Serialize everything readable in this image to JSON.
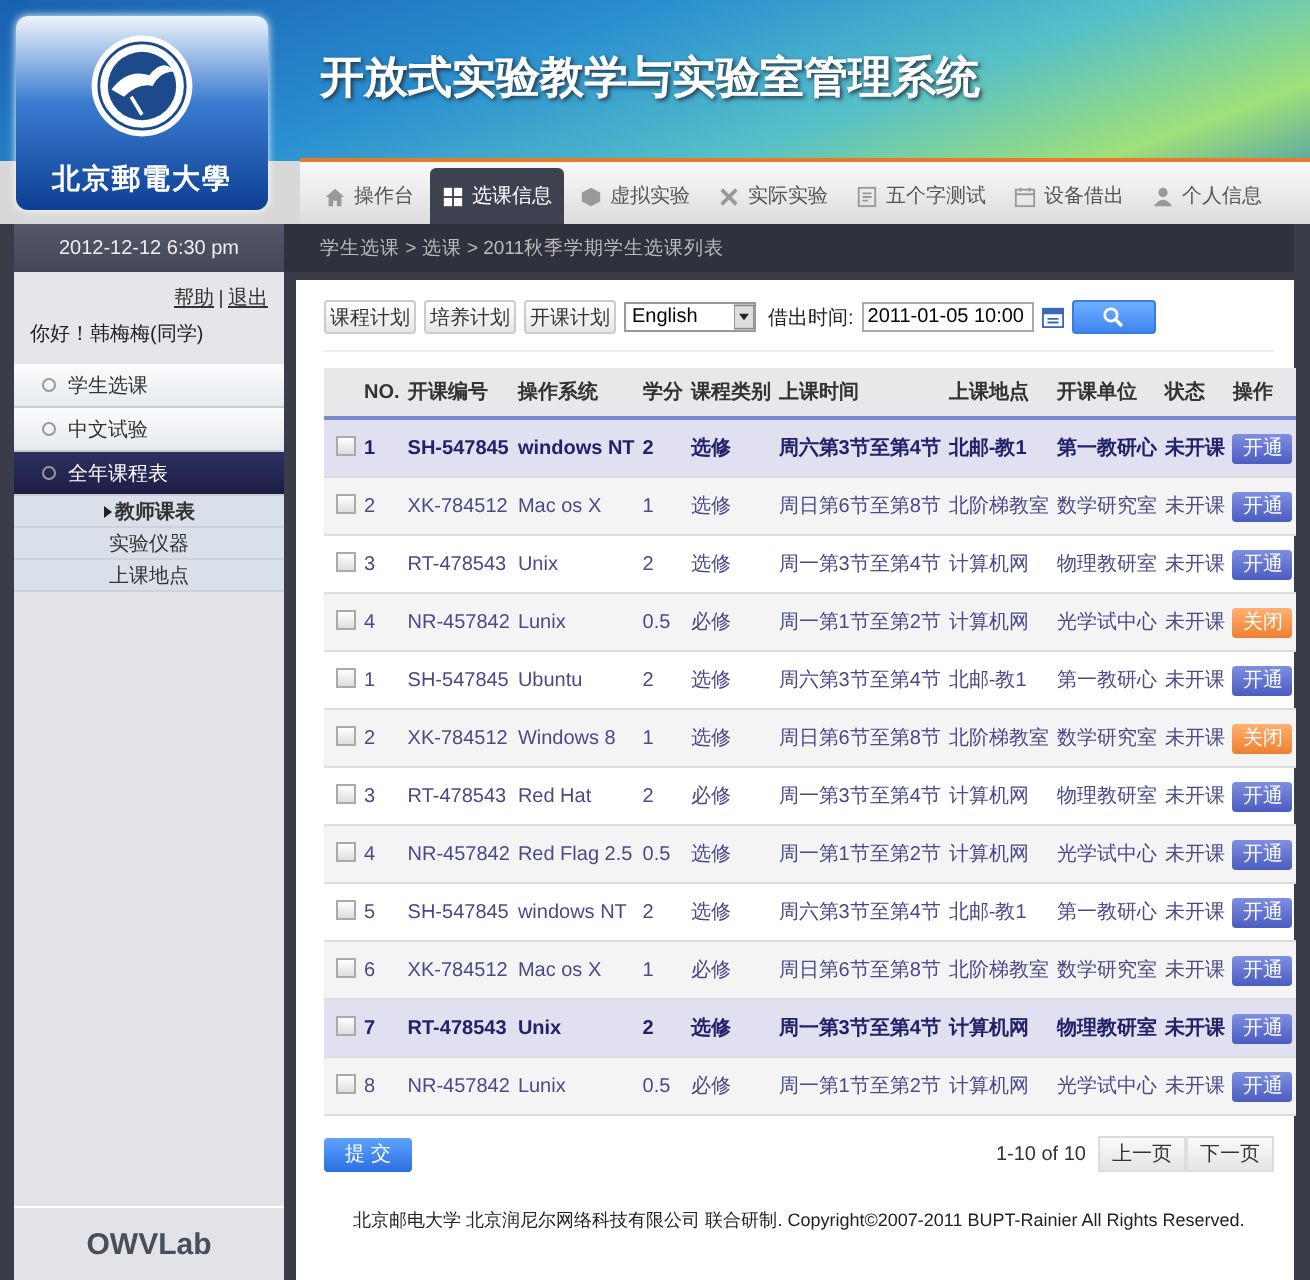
{
  "header": {
    "title": "开放式实验教学与实验室管理系统",
    "logo_text": "北京郵電大學"
  },
  "nav_tabs": [
    {
      "label": "操作台",
      "selected": false
    },
    {
      "label": "选课信息",
      "selected": true
    },
    {
      "label": "虚拟实验",
      "selected": false
    },
    {
      "label": "实际实验",
      "selected": false
    },
    {
      "label": "五个字测试",
      "selected": false
    },
    {
      "label": "设备借出",
      "selected": false
    },
    {
      "label": "个人信息",
      "selected": false
    }
  ],
  "sidebar": {
    "date": "2012-12-12 6:30 pm",
    "links": [
      "帮助",
      "退出"
    ],
    "greeting": "你好！韩梅梅(同学)",
    "menu": [
      {
        "label": "学生选课",
        "selected": false
      },
      {
        "label": "中文试验",
        "selected": false
      },
      {
        "label": "全年课程表",
        "selected": true,
        "children": [
          {
            "label": "教师课表",
            "selected": true
          },
          {
            "label": "实验仪器",
            "selected": false
          },
          {
            "label": "上课地点",
            "selected": false
          }
        ]
      }
    ],
    "brand": "OWVLab"
  },
  "breadcrumb": "学生选课 > 选课 > 2011秋季学期学生选课列表",
  "toolbar": {
    "buttons": [
      "课程计划",
      "培养计划",
      "开课计划"
    ],
    "language": "English",
    "time_label": "借出时间:",
    "time_value": "2011-01-05 10:00"
  },
  "table": {
    "columns": [
      "NO.",
      "开课编号",
      "操作系统",
      "学分",
      "课程类别",
      "上课时间",
      "上课地点",
      "开课单位",
      "状态",
      "操作"
    ],
    "rows": [
      {
        "checked": false,
        "selected": true,
        "cells": [
          "1",
          "SH-547845",
          "windows NT",
          "2",
          "选修",
          "周六第3节至第4节",
          "北邮-教1",
          "第一教研心",
          "未开课"
        ],
        "action": {
          "label": "开通",
          "kind": "open"
        }
      },
      {
        "checked": false,
        "selected": false,
        "cells": [
          "2",
          "XK-784512",
          "Mac os X",
          "1",
          "选修",
          "周日第6节至第8节",
          "北阶梯教室",
          "数学研究室",
          "未开课"
        ],
        "action": {
          "label": "开通",
          "kind": "open"
        }
      },
      {
        "checked": false,
        "selected": false,
        "cells": [
          "3",
          "RT-478543",
          "Unix",
          "2",
          "选修",
          "周一第3节至第4节",
          "计算机网",
          "物理教研室",
          "未开课"
        ],
        "action": {
          "label": "开通",
          "kind": "open"
        }
      },
      {
        "checked": false,
        "selected": false,
        "cells": [
          "4",
          "NR-457842",
          "Lunix",
          "0.5",
          "必修",
          "周一第1节至第2节",
          "计算机网",
          "光学试中心",
          "未开课"
        ],
        "action": {
          "label": "关闭",
          "kind": "close"
        }
      },
      {
        "checked": false,
        "selected": false,
        "cells": [
          "1",
          "SH-547845",
          "Ubuntu",
          "2",
          "选修",
          "周六第3节至第4节",
          "北邮-教1",
          "第一教研心",
          "未开课"
        ],
        "action": {
          "label": "开通",
          "kind": "open"
        }
      },
      {
        "checked": false,
        "selected": false,
        "cells": [
          "2",
          "XK-784512",
          "Windows 8",
          "1",
          "选修",
          "周日第6节至第8节",
          "北阶梯教室",
          "数学研究室",
          "未开课"
        ],
        "action": {
          "label": "关闭",
          "kind": "close"
        }
      },
      {
        "checked": false,
        "selected": false,
        "cells": [
          "3",
          "RT-478543",
          "Red Hat",
          "2",
          "必修",
          "周一第3节至第4节",
          "计算机网",
          "物理教研室",
          "未开课"
        ],
        "action": {
          "label": "开通",
          "kind": "open"
        }
      },
      {
        "checked": false,
        "selected": false,
        "cells": [
          "4",
          "NR-457842",
          "Red Flag 2.5",
          "0.5",
          "选修",
          "周一第1节至第2节",
          "计算机网",
          "光学试中心",
          "未开课"
        ],
        "action": {
          "label": "开通",
          "kind": "open"
        }
      },
      {
        "checked": false,
        "selected": false,
        "cells": [
          "5",
          "SH-547845",
          "windows NT",
          "2",
          "选修",
          "周六第3节至第4节",
          "北邮-教1",
          "第一教研心",
          "未开课"
        ],
        "action": {
          "label": "开通",
          "kind": "open"
        }
      },
      {
        "checked": false,
        "selected": false,
        "cells": [
          "6",
          "XK-784512",
          "Mac os X",
          "1",
          "必修",
          "周日第6节至第8节",
          "北阶梯教室",
          "数学研究室",
          "未开课"
        ],
        "action": {
          "label": "开通",
          "kind": "open"
        }
      },
      {
        "checked": false,
        "selected": true,
        "cells": [
          "7",
          "RT-478543",
          "Unix",
          "2",
          "选修",
          "周一第3节至第4节",
          "计算机网",
          "物理教研室",
          "未开课"
        ],
        "action": {
          "label": "开通",
          "kind": "open"
        }
      },
      {
        "checked": false,
        "selected": false,
        "cells": [
          "8",
          "NR-457842",
          "Lunix",
          "0.5",
          "必修",
          "周一第1节至第2节",
          "计算机网",
          "光学试中心",
          "未开课"
        ],
        "action": {
          "label": "开通",
          "kind": "open"
        }
      }
    ]
  },
  "submit": "提 交",
  "pagination": {
    "summary": "1-10 of 10",
    "prev": "上一页",
    "next": "下一页"
  },
  "footer": "北京邮电大学 北京润尼尔网络科技有限公司 联合研制. Copyright©2007-2011 BUPT-Rainier All Rights Reserved."
}
